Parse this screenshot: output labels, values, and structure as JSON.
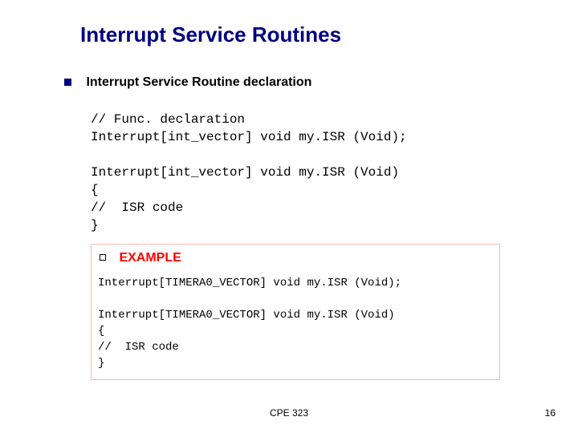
{
  "title": "Interrupt Service Routines",
  "subheading": "Interrupt Service Routine declaration",
  "code_block_1": "// Func. declaration\nInterrupt[int_vector] void my.ISR (Void);\n\nInterrupt[int_vector] void my.ISR (Void)\n{\n//  ISR code\n}",
  "example_label": "EXAMPLE",
  "code_block_2": "Interrupt[TIMERA0_VECTOR] void my.ISR (Void);\n\nInterrupt[TIMERA0_VECTOR] void my.ISR (Void)\n{\n//  ISR code\n}",
  "footer_center": "CPE 323",
  "page_number": "16"
}
